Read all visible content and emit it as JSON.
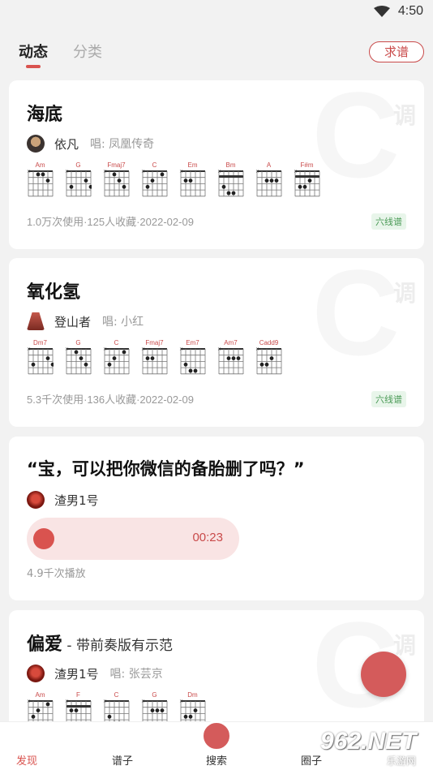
{
  "status": {
    "time": "4:50"
  },
  "tabs": {
    "active": "动态",
    "inactive": "分类",
    "seek_button": "求谱"
  },
  "cards": [
    {
      "title": "海底",
      "watermark_key": "C",
      "watermark_mode": "调",
      "author": "依凡",
      "sing_label": "唱: 凤凰传奇",
      "chords": [
        "Am",
        "G",
        "Fmaj7",
        "C",
        "Em",
        "Bm",
        "A",
        "F#m"
      ],
      "meta": "1.0万次使用·125人收藏·2022-02-09",
      "badge": "六线谱"
    },
    {
      "title": "氧化氢",
      "watermark_key": "C",
      "watermark_mode": "调",
      "author": "登山者",
      "sing_label": "唱: 小红",
      "chords": [
        "Dm7",
        "G",
        "C",
        "Fmaj7",
        "Em7",
        "Am7",
        "Cadd9"
      ],
      "meta": "5.3千次使用·136人收藏·2022-02-09",
      "badge": "六线谱"
    },
    {
      "title": "“宝，可以把你微信的备胎删了吗？”",
      "author": "渣男1号",
      "audio_time": "00:23",
      "plays": "4.9千次播放"
    },
    {
      "title": "偏爱",
      "title_extra": " - 带前奏版有示范",
      "watermark_key": "C",
      "watermark_mode": "调",
      "author": "渣男1号",
      "sing_label": "唱: 张芸京",
      "chords": [
        "Am",
        "F",
        "C",
        "G",
        "Dm"
      ]
    }
  ],
  "nav": {
    "items": [
      "发现",
      "谱子",
      "搜索",
      "圈子"
    ]
  },
  "watermark_logo": {
    "main": "962.NET",
    "sub": "乐游网"
  },
  "colors": {
    "accent": "#d9534f",
    "badge_green": "#4a9a56"
  }
}
